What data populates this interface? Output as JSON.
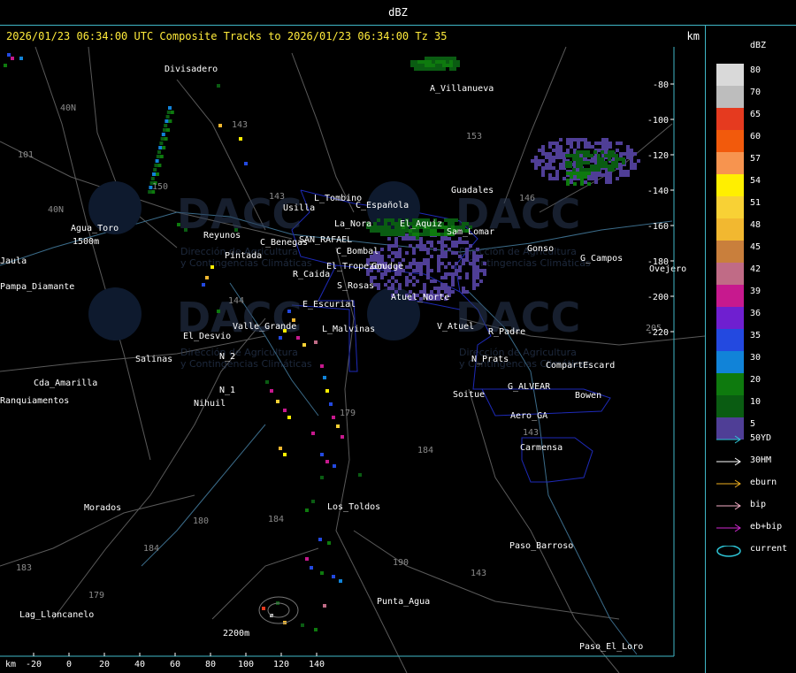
{
  "window_title": "dBZ",
  "header": {
    "timestamp": "2026/01/23 06:34:00 UTC Composite Tracks to 2026/01/23 06:34:00 Tz 35",
    "unit": "km"
  },
  "axis": {
    "x_unit": "km",
    "x_ticks": [
      "-20",
      "0",
      "20",
      "40",
      "60",
      "80",
      "100",
      "120",
      "140"
    ],
    "y_ticks": [
      "-80",
      "-100",
      "-120",
      "-140",
      "-160",
      "-180",
      "-200",
      "-220"
    ]
  },
  "places": [
    "Divisadero",
    "A_Villanueva",
    "Guadales",
    "L_Tombino",
    "Usilla",
    "C_Española",
    "El_Aquiz",
    "Sam_Lomar",
    "La_Nora",
    "C_Benegas",
    "SAN_RAFAEL",
    "C_Bombal",
    "Gonso",
    "G_Campos",
    "Ovejero",
    "Agua_Toro",
    "1500m",
    "Pampa_Diamante",
    "Reyunos",
    "Pintada",
    "R_Caida",
    "S_Rosas",
    "El_Tropezon",
    "Goudge",
    "Atuel_Norte",
    "E_Escurial",
    "Valle_Grande",
    "L_Malvinas",
    "V_Atuel",
    "R_Padre",
    "El_Desvio",
    "Salinas",
    "N_2",
    "N_1",
    "N_Prats",
    "CompartEscard",
    "Cda_Amarilla",
    "Ranquiamentos",
    "Nihuil",
    "Soitue",
    "G_ALVEAR",
    "Bowen",
    "Aero_GA",
    "Carmensa",
    "Los_Toldos",
    "Morados",
    "Paso_Barroso",
    "Punta_Agua",
    "Lag_Llancanelo",
    "2200m",
    "Paso_El_Loro",
    "Jaula"
  ],
  "route_numbers": [
    "143",
    "153",
    "146",
    "40N",
    "101",
    "40N",
    "150",
    "143",
    "144",
    "179",
    "184",
    "180",
    "184",
    "184",
    "183",
    "179",
    "190",
    "143",
    "143",
    "205"
  ],
  "watermark": {
    "logo_text": "DACC",
    "subtitle_lines": [
      "Dirección de Agricultura",
      "y Contingencias Climáticas"
    ]
  },
  "legend": {
    "title": "dBZ",
    "entries": [
      {
        "label": "80",
        "color": "#d9d9d9"
      },
      {
        "label": "70",
        "color": "#bdbdbd"
      },
      {
        "label": "65",
        "color": "#e53a1f"
      },
      {
        "label": "60",
        "color": "#f25a0c"
      },
      {
        "label": "57",
        "color": "#f7944f"
      },
      {
        "label": "54",
        "color": "#ffef00"
      },
      {
        "label": "51",
        "color": "#f8d135"
      },
      {
        "label": "48",
        "color": "#f2b830"
      },
      {
        "label": "45",
        "color": "#c97f3c"
      },
      {
        "label": "42",
        "color": "#c06b86"
      },
      {
        "label": "39",
        "color": "#c7198e"
      },
      {
        "label": "36",
        "color": "#6f1fd0"
      },
      {
        "label": "35",
        "color": "#2349e0"
      },
      {
        "label": "30",
        "color": "#1183d8"
      },
      {
        "label": "20",
        "color": "#0e7a0e"
      },
      {
        "label": "10",
        "color": "#0a5c12"
      },
      {
        "label": "5",
        "color": "#4f3e96"
      }
    ],
    "tracks": [
      {
        "label": "50YD",
        "color": "#2ec6d8"
      },
      {
        "label": "30HM",
        "color": "#ffffff"
      },
      {
        "label": "eburn",
        "color": "#f0b020"
      },
      {
        "label": "bip",
        "color": "#f6b0c8"
      },
      {
        "label": "eb+bip",
        "color": "#d028d0"
      },
      {
        "label": "current",
        "color": "#2ec6d8"
      }
    ]
  }
}
